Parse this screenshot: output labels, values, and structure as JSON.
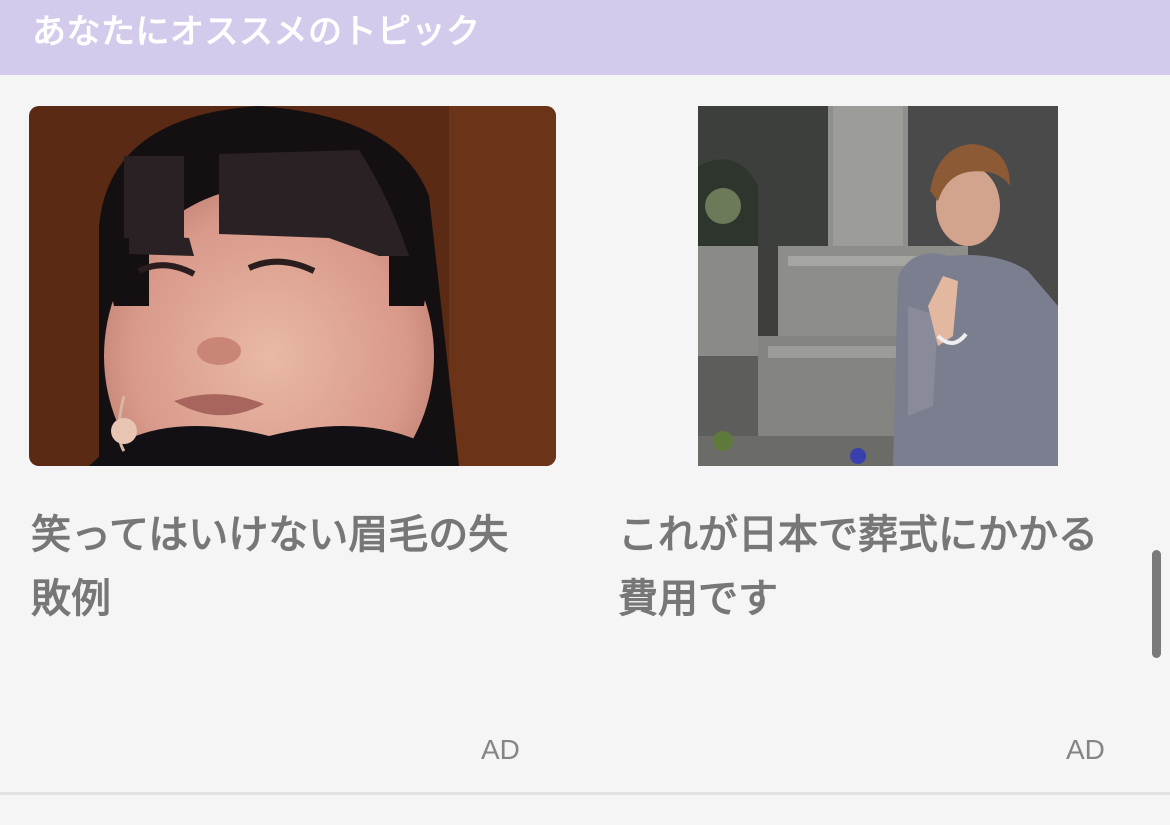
{
  "header": {
    "title": "あなたにオススメのトピック",
    "background_color": "#d3caec"
  },
  "cards": [
    {
      "title": "笑ってはいけない眉毛の失敗例",
      "ad_label": "AD",
      "image": "photo-woman-with-thick-drawn-eyebrows"
    },
    {
      "title": "これが日本で葬式にかかる費用です",
      "ad_label": "AD",
      "image": "photo-elderly-woman-praying-at-grave"
    }
  ]
}
